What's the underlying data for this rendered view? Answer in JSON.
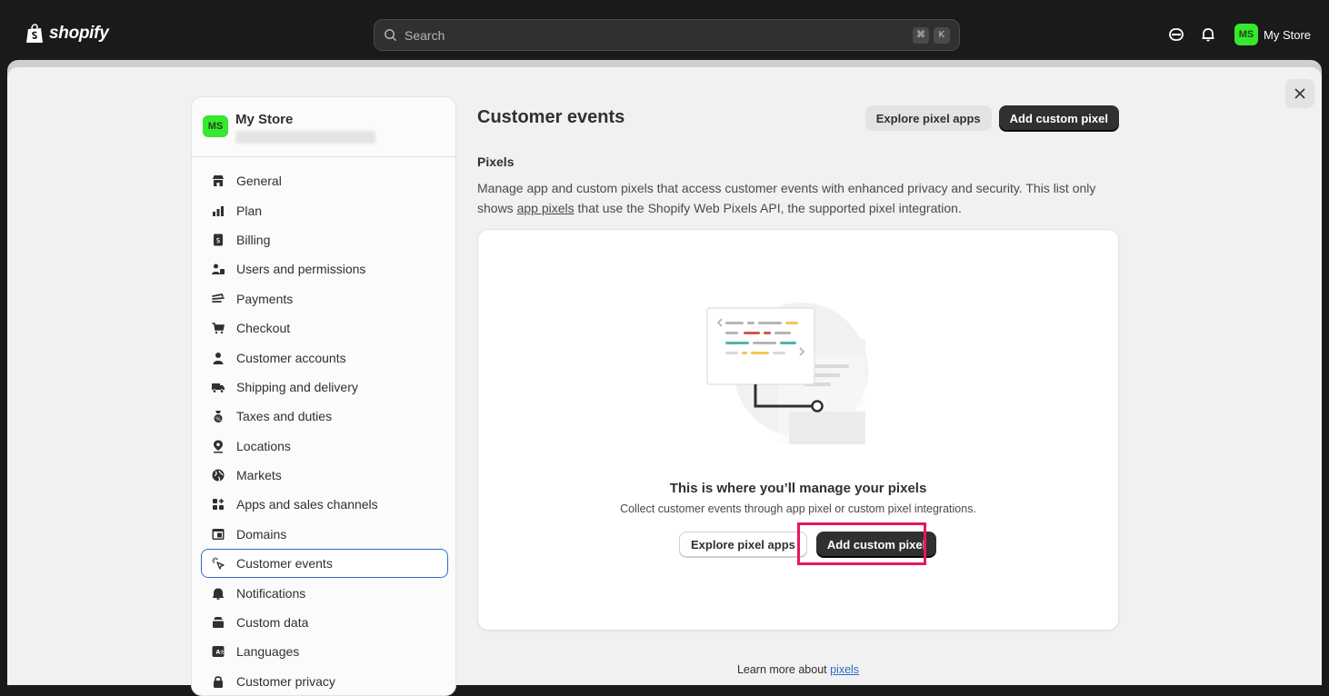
{
  "topbar": {
    "logo_text": "shopify",
    "search_placeholder": "Search",
    "search_shortcut": [
      "⌘",
      "K"
    ],
    "store_initials": "MS",
    "store_name": "My Store"
  },
  "sidebar": {
    "store_initials": "MS",
    "store_name": "My Store",
    "items": [
      {
        "label": "General",
        "icon": "store-icon"
      },
      {
        "label": "Plan",
        "icon": "plan-icon"
      },
      {
        "label": "Billing",
        "icon": "billing-icon"
      },
      {
        "label": "Users and permissions",
        "icon": "users-icon"
      },
      {
        "label": "Payments",
        "icon": "payments-icon"
      },
      {
        "label": "Checkout",
        "icon": "cart-icon"
      },
      {
        "label": "Customer accounts",
        "icon": "person-icon"
      },
      {
        "label": "Shipping and delivery",
        "icon": "truck-icon"
      },
      {
        "label": "Taxes and duties",
        "icon": "taxes-icon"
      },
      {
        "label": "Locations",
        "icon": "location-icon"
      },
      {
        "label": "Markets",
        "icon": "globe-icon"
      },
      {
        "label": "Apps and sales channels",
        "icon": "apps-icon"
      },
      {
        "label": "Domains",
        "icon": "domains-icon"
      },
      {
        "label": "Customer events",
        "icon": "cursor-click-icon",
        "active": true
      },
      {
        "label": "Notifications",
        "icon": "bell-icon"
      },
      {
        "label": "Custom data",
        "icon": "database-icon"
      },
      {
        "label": "Languages",
        "icon": "language-icon"
      },
      {
        "label": "Customer privacy",
        "icon": "lock-icon"
      }
    ]
  },
  "main": {
    "title": "Customer events",
    "explore_label": "Explore pixel apps",
    "add_label": "Add custom pixel",
    "section_title": "Pixels",
    "desc_before": "Manage app and custom pixels that access customer events with enhanced privacy and security. This list only shows ",
    "desc_link": "app pixels",
    "desc_after": " that use the Shopify Web Pixels API, the supported pixel integration.",
    "empty_title": "This is where you’ll manage your pixels",
    "empty_subtitle": "Collect customer events through app pixel or custom pixel integrations.",
    "empty_explore_label": "Explore pixel apps",
    "empty_add_label": "Add custom pixel",
    "learn_text": "Learn more about ",
    "learn_link": "pixels"
  },
  "colors": {
    "accent_blue": "#2c6ecb",
    "avatar_green": "#36e82e",
    "highlight": "#e8195a"
  }
}
